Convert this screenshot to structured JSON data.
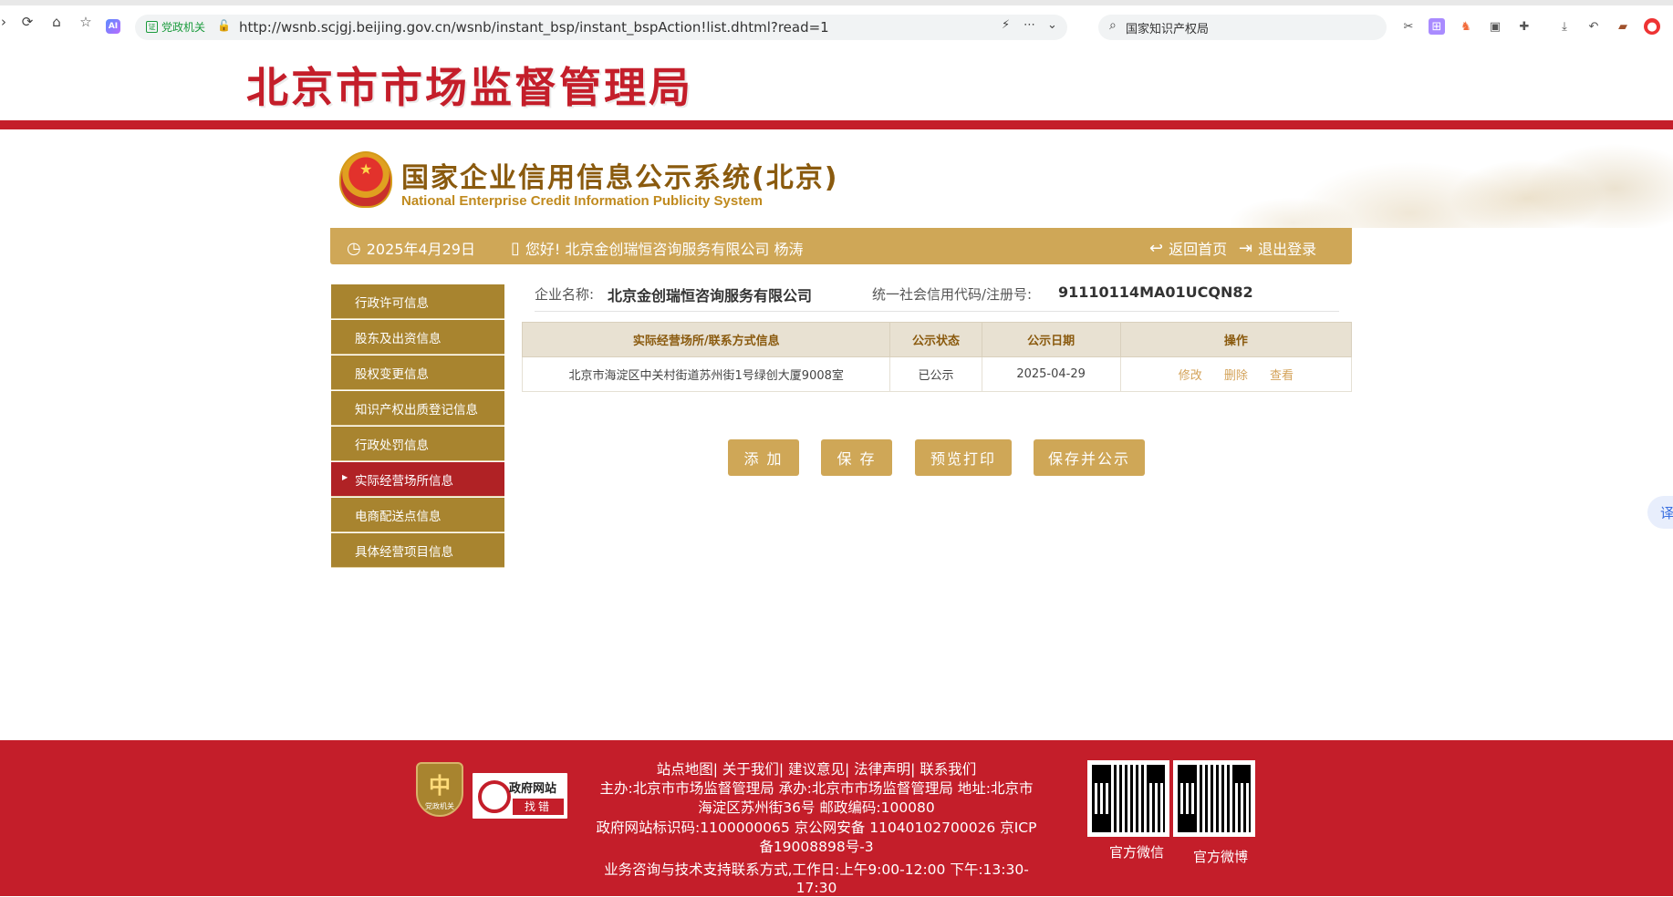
{
  "browser": {
    "gov_tag": "党政机关",
    "url": "http://wsnb.scjgj.beijing.gov.cn/wsnb/instant_bsp/instant_bspAction!list.dhtml?read=1",
    "search_value": "国家知识产权局",
    "ai_label": "AI"
  },
  "header": {
    "bureau_title": "北京市市场监督管理局",
    "system_title_cn": "国家企业信用信息公示系统(北京)",
    "system_title_en": "National Enterprise Credit Information Publicity System"
  },
  "info_bar": {
    "date": "2025年4月29日",
    "greeting": "您好!  北京金创瑞恒咨询服务有限公司  杨涛",
    "home": "返回首页",
    "logout": "退出登录"
  },
  "sidebar": {
    "items": [
      {
        "label": "行政许可信息"
      },
      {
        "label": "股东及出资信息"
      },
      {
        "label": "股权变更信息"
      },
      {
        "label": "知识产权出质登记信息"
      },
      {
        "label": "行政处罚信息"
      },
      {
        "label": "实际经营场所信息"
      },
      {
        "label": "电商配送点信息"
      },
      {
        "label": "具体经营项目信息"
      }
    ]
  },
  "company": {
    "name_label": "企业名称:",
    "name": "北京金创瑞恒咨询服务有限公司",
    "code_label": "统一社会信用代码/注册号:",
    "code": "91110114MA01UCQN82"
  },
  "table": {
    "headers": [
      "实际经营场所/联系方式信息",
      "公示状态",
      "公示日期",
      "操作"
    ],
    "rows": [
      {
        "address": "北京市海淀区中关村街道苏州街1号绿创大厦9008室",
        "status": "已公示",
        "date": "2025-04-29",
        "ops": [
          "修改",
          "删除",
          "查看"
        ]
      }
    ]
  },
  "buttons": {
    "add": "添 加",
    "save": "保 存",
    "preview": "预览打印",
    "save_publish": "保存并公示"
  },
  "translate_label": "译",
  "footer": {
    "badge_text": "党政机关",
    "badge_glyph": "中",
    "gov_corr_line1": "政府网站",
    "gov_corr_line2": "找错",
    "links": "站点地图| 关于我们| 建议意见| 法律声明| 联系我们",
    "line2": "主办:北京市市场监督管理局 承办:北京市市场监督管理局 地址:北京市",
    "line3": "海淀区苏州街36号 邮政编码:100080",
    "line4": "政府网站标识码:1100000065     京公网安备 11040102700026     京ICP",
    "line5": "备19008898号-3",
    "line6": "业务咨询与技术支持联系方式,工作日:上午9:00-12:00 下午:13:30-",
    "line7": "17:30",
    "qr1_label": "官方微信",
    "qr2_label": "官方微博"
  }
}
